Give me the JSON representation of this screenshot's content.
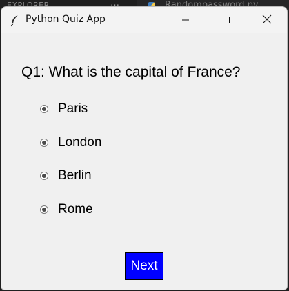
{
  "background_editor": {
    "panel_label": "EXPLORER",
    "overflow_glyph": "…",
    "tab_label": "Randompassword.py"
  },
  "window": {
    "title": "Python Quiz App",
    "icon": "feather-icon",
    "controls": {
      "minimize": "minimize-icon",
      "maximize": "maximize-icon",
      "close": "close-icon"
    }
  },
  "quiz": {
    "question": "Q1: What is the capital of France?",
    "options": [
      "Paris",
      "London",
      "Berlin",
      "Rome"
    ],
    "next_label": "Next"
  },
  "colors": {
    "next_button_bg": "#0000ff",
    "next_button_text": "#ffffff",
    "window_bg": "#f0f0f0"
  }
}
